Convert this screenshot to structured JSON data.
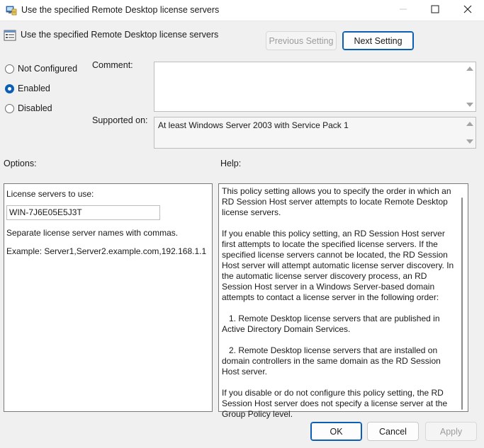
{
  "window": {
    "title": "Use the specified Remote Desktop license servers"
  },
  "header": {
    "title": "Use the specified Remote Desktop license servers",
    "prev_label": "Previous Setting",
    "next_label": "Next Setting"
  },
  "state": {
    "options": [
      {
        "label": "Not Configured",
        "checked": false
      },
      {
        "label": "Enabled",
        "checked": true
      },
      {
        "label": "Disabled",
        "checked": false
      }
    ]
  },
  "comment": {
    "label": "Comment:",
    "value": ""
  },
  "supported": {
    "label": "Supported on:",
    "value": "At least Windows Server 2003 with Service Pack 1"
  },
  "options_panel": {
    "heading": "Options:",
    "servers_label": "License servers to use:",
    "servers_value": "WIN-7J6E05E5J3T",
    "note": "Separate license server names with commas.",
    "example": "Example: Server1,Server2.example.com,192.168.1.1"
  },
  "help_panel": {
    "heading": "Help:",
    "paragraphs": [
      "This policy setting allows you to specify the order in which an RD Session Host server attempts to locate Remote Desktop license servers.",
      "If you enable this policy setting, an RD Session Host server first attempts to locate the specified license servers. If the specified license servers cannot be located, the RD Session Host server will attempt automatic license server discovery. In the automatic license server discovery process, an RD Session Host server in a Windows Server-based domain attempts to contact a license server in the following order:",
      "1. Remote Desktop license servers that are published in Active Directory Domain Services.",
      "2. Remote Desktop license servers that are installed on domain controllers in the same domain as the RD Session Host server.",
      "If you disable or do not configure this policy setting, the RD Session Host server does not specify a license server at the Group Policy level."
    ]
  },
  "footer": {
    "ok_label": "OK",
    "cancel_label": "Cancel",
    "apply_label": "Apply"
  },
  "icons": {
    "title": "policy-window-icon",
    "header": "policy-setting-icon",
    "minimize": "minimize-icon",
    "maximize": "maximize-icon",
    "close": "close-icon"
  },
  "colors": {
    "accent": "#0a5fb4",
    "background": "#f0f0f0"
  }
}
